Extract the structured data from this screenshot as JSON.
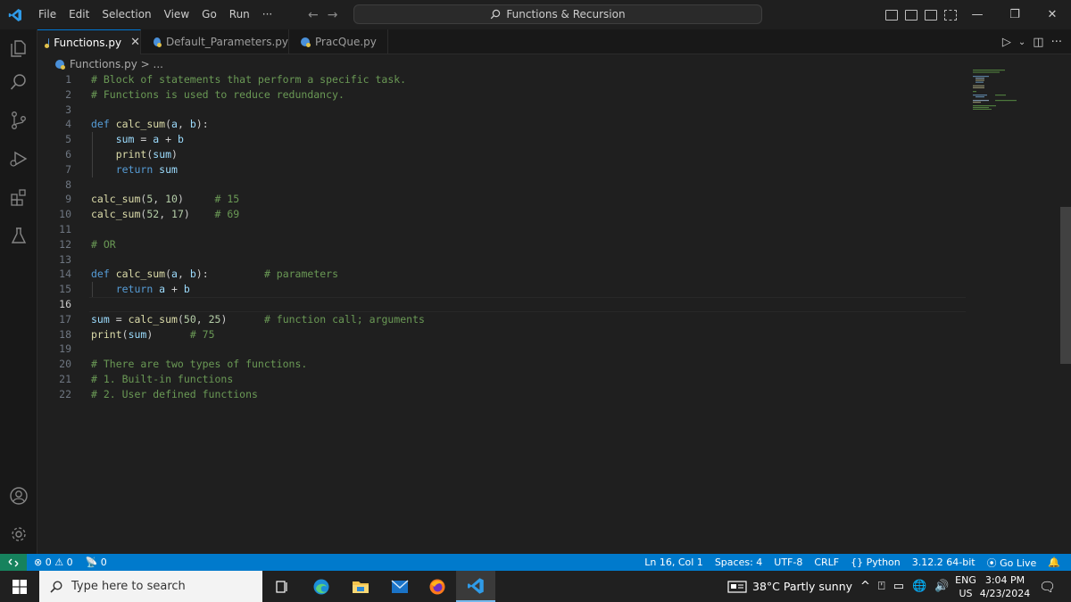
{
  "menu": [
    "File",
    "Edit",
    "Selection",
    "View",
    "Go",
    "Run",
    "···"
  ],
  "command_center": "Functions & Recursion",
  "tabs": [
    {
      "label": "Functions.py",
      "active": true
    },
    {
      "label": "Default_Parameters.py",
      "active": false
    },
    {
      "label": "PracQue.py",
      "active": false
    }
  ],
  "breadcrumb": "Functions.py > ...",
  "current_line": 16,
  "code_lines": [
    {
      "n": "1",
      "tokens": [
        [
          "cm",
          "# Block of statements that perform a specific task."
        ]
      ]
    },
    {
      "n": "2",
      "tokens": [
        [
          "cm",
          "# Functions is used to reduce redundancy."
        ]
      ]
    },
    {
      "n": "3",
      "tokens": []
    },
    {
      "n": "4",
      "tokens": [
        [
          "kw",
          "def "
        ],
        [
          "fn",
          "calc_sum"
        ],
        [
          "",
          "("
        ],
        [
          "var",
          "a"
        ],
        [
          "",
          ", "
        ],
        [
          "var",
          "b"
        ],
        [
          "",
          "):"
        ]
      ]
    },
    {
      "n": "5",
      "tokens": [
        [
          "",
          "    "
        ],
        [
          "var",
          "sum"
        ],
        [
          "",
          " = "
        ],
        [
          "var",
          "a"
        ],
        [
          "",
          " + "
        ],
        [
          "var",
          "b"
        ]
      ]
    },
    {
      "n": "6",
      "tokens": [
        [
          "",
          "    "
        ],
        [
          "fn",
          "print"
        ],
        [
          "",
          "("
        ],
        [
          "var",
          "sum"
        ],
        [
          "",
          ")"
        ]
      ]
    },
    {
      "n": "7",
      "tokens": [
        [
          "",
          "    "
        ],
        [
          "kw",
          "return "
        ],
        [
          "var",
          "sum"
        ]
      ]
    },
    {
      "n": "8",
      "tokens": []
    },
    {
      "n": "9",
      "tokens": [
        [
          "fn",
          "calc_sum"
        ],
        [
          "",
          "("
        ],
        [
          "num",
          "5"
        ],
        [
          "",
          ", "
        ],
        [
          "num",
          "10"
        ],
        [
          "",
          ")     "
        ],
        [
          "cm",
          "# 15"
        ]
      ]
    },
    {
      "n": "10",
      "tokens": [
        [
          "fn",
          "calc_sum"
        ],
        [
          "",
          "("
        ],
        [
          "num",
          "52"
        ],
        [
          "",
          ", "
        ],
        [
          "num",
          "17"
        ],
        [
          "",
          ")    "
        ],
        [
          "cm",
          "# 69"
        ]
      ]
    },
    {
      "n": "11",
      "tokens": []
    },
    {
      "n": "12",
      "tokens": [
        [
          "cm",
          "# OR"
        ]
      ]
    },
    {
      "n": "13",
      "tokens": []
    },
    {
      "n": "14",
      "tokens": [
        [
          "kw",
          "def "
        ],
        [
          "fn",
          "calc_sum"
        ],
        [
          "",
          "("
        ],
        [
          "var",
          "a"
        ],
        [
          "",
          ", "
        ],
        [
          "var",
          "b"
        ],
        [
          "",
          "):         "
        ],
        [
          "cm",
          "# parameters"
        ]
      ]
    },
    {
      "n": "15",
      "tokens": [
        [
          "",
          "    "
        ],
        [
          "kw",
          "return "
        ],
        [
          "var",
          "a"
        ],
        [
          "",
          " + "
        ],
        [
          "var",
          "b"
        ]
      ]
    },
    {
      "n": "16",
      "tokens": []
    },
    {
      "n": "17",
      "tokens": [
        [
          "var",
          "sum"
        ],
        [
          "",
          " = "
        ],
        [
          "fn",
          "calc_sum"
        ],
        [
          "",
          "("
        ],
        [
          "num",
          "50"
        ],
        [
          "",
          ", "
        ],
        [
          "num",
          "25"
        ],
        [
          "",
          ")      "
        ],
        [
          "cm",
          "# function call; arguments"
        ]
      ]
    },
    {
      "n": "18",
      "tokens": [
        [
          "fn",
          "print"
        ],
        [
          "",
          "("
        ],
        [
          "var",
          "sum"
        ],
        [
          "",
          ")      "
        ],
        [
          "cm",
          "# 75"
        ]
      ]
    },
    {
      "n": "19",
      "tokens": []
    },
    {
      "n": "20",
      "tokens": [
        [
          "cm",
          "# There are two types of functions."
        ]
      ]
    },
    {
      "n": "21",
      "tokens": [
        [
          "cm",
          "# 1. Built-in functions"
        ]
      ]
    },
    {
      "n": "22",
      "tokens": [
        [
          "cm",
          "# 2. User defined functions"
        ]
      ]
    }
  ],
  "status": {
    "errors": "0",
    "warnings": "0",
    "ports": "0",
    "position": "Ln 16, Col 1",
    "spaces": "Spaces: 4",
    "encoding": "UTF-8",
    "eol": "CRLF",
    "language": "Python",
    "interpreter": "3.12.2 64-bit",
    "golive": "Go Live"
  },
  "taskbar": {
    "search_placeholder": "Type here to search",
    "weather": "38°C  Partly sunny",
    "lang_top": "ENG",
    "lang_bottom": "US",
    "time": "3:04 PM",
    "date": "4/23/2024"
  }
}
